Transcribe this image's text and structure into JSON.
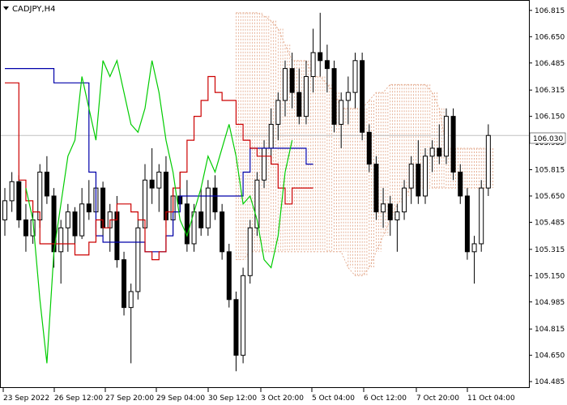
{
  "window": {
    "symbol_label": "CADJPY,H4",
    "menu_icon": "triangle-down-icon"
  },
  "price_axis": {
    "labels": [
      "106.815",
      "106.650",
      "106.485",
      "106.315",
      "106.150",
      "105.985",
      "105.815",
      "105.650",
      "105.485",
      "105.315",
      "105.150",
      "104.985",
      "104.815",
      "104.650",
      "104.485"
    ],
    "current_price": "106.030"
  },
  "time_axis": {
    "labels": [
      "23 Sep 2022",
      "26 Sep 12:00",
      "27 Sep 20:00",
      "29 Sep 04:00",
      "30 Sep 12:00",
      "3 Oct 20:00",
      "5 Oct 04:00",
      "6 Oct 12:00",
      "7 Oct 20:00",
      "11 Oct 04:00"
    ]
  },
  "chart_data": {
    "type": "candlestick",
    "title": "CADJPY,H4",
    "ylim": [
      104.46,
      106.86
    ],
    "current_price": 106.03,
    "colors": {
      "tenkan": "#cc0000",
      "kijun": "#0000aa",
      "chikou": "#00cc00",
      "cloud": "#e0a080",
      "candle": "#000000",
      "current_line": "#c0c0c0"
    },
    "candles": [
      [
        105.5,
        105.7,
        105.4,
        105.62
      ],
      [
        105.62,
        105.8,
        105.55,
        105.74
      ],
      [
        105.74,
        105.78,
        105.45,
        105.5
      ],
      [
        105.5,
        105.6,
        105.3,
        105.4
      ],
      [
        105.4,
        105.55,
        105.35,
        105.5
      ],
      [
        105.5,
        105.85,
        105.45,
        105.8
      ],
      [
        105.8,
        105.9,
        105.6,
        105.65
      ],
      [
        105.65,
        105.7,
        105.2,
        105.3
      ],
      [
        105.3,
        105.5,
        105.1,
        105.45
      ],
      [
        105.45,
        105.6,
        105.3,
        105.55
      ],
      [
        105.55,
        105.58,
        105.35,
        105.4
      ],
      [
        105.4,
        105.7,
        105.38,
        105.6
      ],
      [
        105.6,
        105.75,
        105.5,
        105.55
      ],
      [
        105.55,
        105.8,
        105.45,
        105.7
      ],
      [
        105.7,
        105.74,
        105.4,
        105.45
      ],
      [
        105.45,
        105.6,
        105.3,
        105.55
      ],
      [
        105.55,
        105.65,
        105.2,
        105.25
      ],
      [
        105.25,
        105.3,
        104.9,
        104.95
      ],
      [
        104.95,
        105.1,
        104.6,
        105.05
      ],
      [
        105.05,
        105.5,
        105.0,
        105.45
      ],
      [
        105.45,
        105.85,
        105.4,
        105.75
      ],
      [
        105.75,
        105.95,
        105.6,
        105.7
      ],
      [
        105.7,
        105.85,
        105.55,
        105.8
      ],
      [
        105.8,
        105.9,
        105.45,
        105.5
      ],
      [
        105.5,
        105.7,
        105.4,
        105.65
      ],
      [
        105.65,
        105.8,
        105.55,
        105.6
      ],
      [
        105.6,
        105.75,
        105.3,
        105.35
      ],
      [
        105.35,
        105.6,
        105.3,
        105.55
      ],
      [
        105.55,
        105.7,
        105.4,
        105.45
      ],
      [
        105.45,
        105.75,
        105.4,
        105.7
      ],
      [
        105.7,
        105.78,
        105.5,
        105.55
      ],
      [
        105.55,
        105.6,
        105.25,
        105.3
      ],
      [
        105.3,
        105.35,
        104.95,
        105.0
      ],
      [
        105.0,
        105.05,
        104.55,
        104.65
      ],
      [
        104.65,
        105.2,
        104.6,
        105.15
      ],
      [
        105.15,
        105.5,
        105.1,
        105.45
      ],
      [
        105.45,
        105.8,
        105.4,
        105.75
      ],
      [
        105.75,
        106.0,
        105.7,
        105.95
      ],
      [
        105.95,
        106.2,
        105.85,
        106.1
      ],
      [
        106.1,
        106.3,
        106.0,
        106.25
      ],
      [
        106.25,
        106.5,
        106.15,
        106.45
      ],
      [
        106.45,
        106.55,
        106.2,
        106.3
      ],
      [
        106.3,
        106.45,
        106.1,
        106.15
      ],
      [
        106.15,
        106.5,
        106.1,
        106.4
      ],
      [
        106.4,
        106.7,
        106.3,
        106.55
      ],
      [
        106.55,
        106.8,
        106.4,
        106.5
      ],
      [
        106.5,
        106.6,
        106.3,
        106.45
      ],
      [
        106.45,
        106.5,
        106.05,
        106.1
      ],
      [
        106.1,
        106.3,
        105.95,
        106.25
      ],
      [
        106.25,
        106.4,
        106.1,
        106.3
      ],
      [
        106.3,
        106.55,
        106.2,
        106.5
      ],
      [
        106.5,
        106.55,
        106.0,
        106.05
      ],
      [
        106.05,
        106.1,
        105.8,
        105.85
      ],
      [
        105.85,
        105.9,
        105.5,
        105.55
      ],
      [
        105.55,
        105.7,
        105.45,
        105.6
      ],
      [
        105.6,
        105.65,
        105.4,
        105.5
      ],
      [
        105.5,
        105.6,
        105.3,
        105.55
      ],
      [
        105.55,
        105.75,
        105.5,
        105.7
      ],
      [
        105.7,
        105.9,
        105.6,
        105.85
      ],
      [
        105.85,
        106.0,
        105.6,
        105.65
      ],
      [
        105.65,
        105.95,
        105.6,
        105.9
      ],
      [
        105.9,
        106.0,
        105.8,
        105.95
      ],
      [
        105.95,
        106.1,
        105.85,
        105.9
      ],
      [
        105.9,
        106.2,
        105.85,
        106.15
      ],
      [
        106.15,
        106.2,
        105.75,
        105.8
      ],
      [
        105.8,
        105.85,
        105.6,
        105.65
      ],
      [
        105.65,
        105.7,
        105.25,
        105.3
      ],
      [
        105.3,
        105.4,
        105.1,
        105.35
      ],
      [
        105.35,
        105.75,
        105.3,
        105.7
      ],
      [
        105.7,
        106.1,
        105.65,
        106.03
      ]
    ],
    "tenkan": [
      106.36,
      106.36,
      105.75,
      105.62,
      105.55,
      105.35,
      105.35,
      105.35,
      105.35,
      105.35,
      105.28,
      105.28,
      105.36,
      105.5,
      105.45,
      105.5,
      105.6,
      105.6,
      105.55,
      105.5,
      105.3,
      105.25,
      105.3,
      105.55,
      105.7,
      105.8,
      106.0,
      106.15,
      106.25,
      106.4,
      106.3,
      106.25,
      106.25,
      106.1,
      106.0,
      105.95,
      105.9,
      105.9,
      105.85,
      105.7,
      105.6,
      105.7,
      105.7,
      105.7
    ],
    "kijun": [
      106.45,
      106.45,
      106.45,
      106.45,
      106.45,
      106.45,
      106.45,
      106.36,
      106.36,
      106.36,
      106.36,
      106.36,
      105.8,
      105.4,
      105.36,
      105.36,
      105.36,
      105.36,
      105.36,
      105.36,
      105.3,
      105.3,
      105.3,
      105.4,
      105.55,
      105.65,
      105.65,
      105.65,
      105.65,
      105.65,
      105.65,
      105.65,
      105.65,
      105.65,
      105.8,
      105.95,
      105.95,
      105.95,
      105.95,
      105.95,
      105.95,
      105.95,
      105.95,
      105.85
    ],
    "chikou": [
      105.7,
      105.5,
      105.0,
      104.6,
      105.3,
      105.6,
      105.9,
      106.0,
      106.4,
      106.2,
      106.0,
      106.5,
      106.4,
      106.5,
      106.3,
      106.1,
      106.05,
      106.2,
      106.5,
      106.3,
      106.0,
      105.8,
      105.5,
      105.4,
      105.55,
      105.7,
      105.9,
      105.8,
      105.95,
      106.1,
      105.9,
      105.6,
      105.65,
      105.5,
      105.25,
      105.2,
      105.4,
      105.8,
      106.0
    ],
    "cloud": {
      "start_index": 33,
      "top": [
        106.8,
        106.8,
        106.8,
        106.8,
        106.78,
        106.75,
        106.7,
        106.6,
        106.5,
        106.5,
        106.5,
        106.4,
        106.4,
        106.35,
        106.3,
        106.2,
        106.2,
        106.2,
        106.2,
        106.25,
        106.3,
        106.3,
        106.35,
        106.35,
        106.35,
        106.35,
        106.35,
        106.35,
        106.3,
        106.2,
        105.95,
        105.95,
        105.95,
        105.95,
        105.95,
        105.95,
        105.95
      ],
      "bottom": [
        105.25,
        105.25,
        105.3,
        105.3,
        105.3,
        105.3,
        105.3,
        105.3,
        105.3,
        105.3,
        105.3,
        105.3,
        105.3,
        105.3,
        105.3,
        105.3,
        105.2,
        105.15,
        105.15,
        105.2,
        105.3,
        105.4,
        105.5,
        105.6,
        105.65,
        105.7,
        105.7,
        105.7,
        105.7,
        105.7,
        105.7,
        105.7,
        105.7,
        105.7,
        105.7,
        105.7,
        105.7
      ]
    }
  }
}
